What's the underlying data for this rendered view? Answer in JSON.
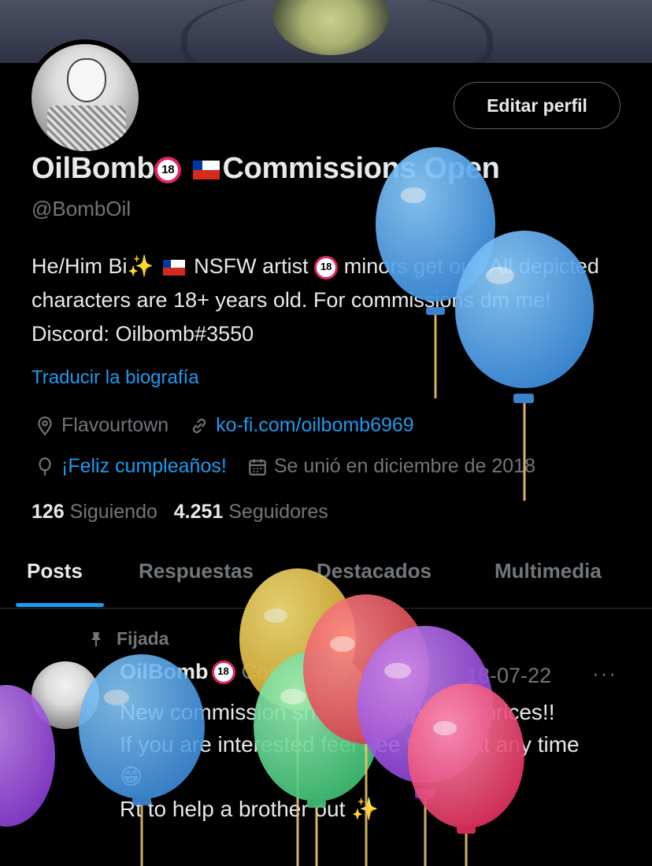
{
  "profile": {
    "name": "OilBomb",
    "badge": "18",
    "title_suffix": "Commissions Open",
    "handle": "@BombOil",
    "edit_button": "Editar perfil",
    "bio": {
      "p1": "He/Him Bi",
      "p2": "NSFW artist",
      "p3": "minors get out! All depicted characters are 18+ years old. For commissions dm me! Discord: Oilbomb#3550"
    },
    "translate": "Traducir la biografía",
    "location": "Flavourtown",
    "website": "ko-fi.com/oilbomb6969",
    "birthday": "¡Feliz cumpleaños!",
    "joined": "Se unió en diciembre de 2018",
    "following_count": "126",
    "following_label": "Siguiendo",
    "followers_count": "4.251",
    "followers_label": "Seguidores"
  },
  "tabs": [
    "Posts",
    "Respuestas",
    "Destacados",
    "Multimedia"
  ],
  "post": {
    "pinned_label": "Fijada",
    "author": "OilBomb",
    "author_tail": "Commissio...",
    "date": "18-07-22",
    "more": "···",
    "line1": "New commission sheet with updated prices!!",
    "line2": "If you are interested feel free to DM at any time",
    "line3": "Rt to help a brother out"
  },
  "icons": {
    "location": "location-pin-icon",
    "link": "link-icon",
    "birthday": "balloon-icon",
    "calendar": "calendar-icon",
    "pin": "pin-icon",
    "sparkles": "sparkles-icon",
    "grin": "grinning-face-icon"
  },
  "colors": {
    "accent": "#1d9bf0",
    "muted": "#71767b",
    "text": "#e7e9ea",
    "background": "#000000"
  }
}
